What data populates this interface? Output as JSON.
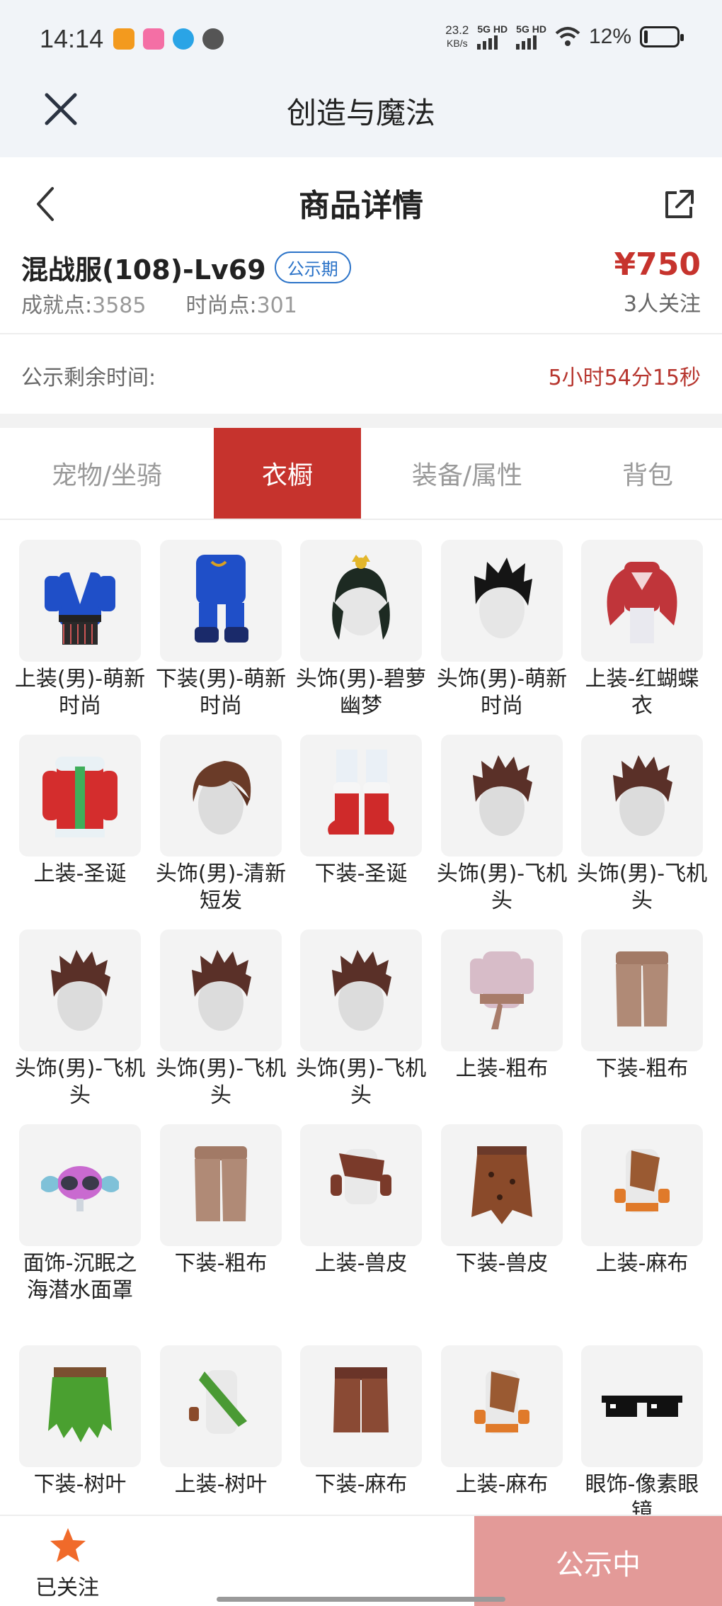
{
  "status_bar": {
    "time": "14:14",
    "net_speed": "23.2",
    "net_speed_unit": "KB/s",
    "sim1": "5G HD",
    "sim2": "5G HD",
    "battery_pct": "12%",
    "battery_level": 0.12
  },
  "app_header": {
    "title": "创造与魔法"
  },
  "page_header": {
    "title": "商品详情"
  },
  "product": {
    "name": "混战服(108)-Lv69",
    "badge": "公示期",
    "achievement_label": "成就点:",
    "achievement_value": "3585",
    "fashion_label": "时尚点:",
    "fashion_value": "301",
    "price": "¥750",
    "followers": "3人关注"
  },
  "countdown": {
    "label": "公示剩余时间:",
    "value": "5小时54分15秒"
  },
  "tabs": [
    {
      "label": "宠物/坐骑",
      "active": false
    },
    {
      "label": "衣橱",
      "active": true
    },
    {
      "label": "装备/属性",
      "active": false
    },
    {
      "label": "背包",
      "active": false
    }
  ],
  "items": [
    {
      "label": "上装(男)-萌新时尚",
      "icon": "blue-robe-icon"
    },
    {
      "label": "下装(男)-萌新时尚",
      "icon": "blue-pants-icon"
    },
    {
      "label": "头饰(男)-碧萝幽梦",
      "icon": "dark-hair-ornament-icon"
    },
    {
      "label": "头饰(男)-萌新时尚",
      "icon": "black-hair-icon"
    },
    {
      "label": "上装-红蝴蝶衣",
      "icon": "red-butterfly-top-icon"
    },
    {
      "label": "上装-圣诞",
      "icon": "christmas-coat-icon"
    },
    {
      "label": "头饰(男)-清新短发",
      "icon": "brown-short-hair-icon"
    },
    {
      "label": "下装-圣诞",
      "icon": "christmas-boots-icon"
    },
    {
      "label": "头饰(男)-飞机头",
      "icon": "pompadour-hair-icon"
    },
    {
      "label": "头饰(男)-飞机头",
      "icon": "pompadour-hair-icon"
    },
    {
      "label": "头饰(男)-飞机头",
      "icon": "pompadour-hair-icon"
    },
    {
      "label": "头饰(男)-飞机头",
      "icon": "pompadour-hair-icon"
    },
    {
      "label": "头饰(男)-飞机头",
      "icon": "pompadour-hair-icon"
    },
    {
      "label": "上装-粗布",
      "icon": "cloth-top-icon"
    },
    {
      "label": "下装-粗布",
      "icon": "cloth-shorts-icon"
    },
    {
      "label": "面饰-沉眠之海潜水面罩",
      "icon": "diving-mask-icon"
    },
    {
      "label": "下装-粗布",
      "icon": "cloth-shorts-icon"
    },
    {
      "label": "上装-兽皮",
      "icon": "beast-hide-top-icon"
    },
    {
      "label": "下装-兽皮",
      "icon": "beast-hide-skirt-icon"
    },
    {
      "label": "上装-麻布",
      "icon": "linen-top-icon"
    },
    {
      "label": "下装-树叶",
      "icon": "leaf-skirt-icon"
    },
    {
      "label": "上装-树叶",
      "icon": "leaf-top-icon"
    },
    {
      "label": "下装-麻布",
      "icon": "linen-shorts-icon"
    },
    {
      "label": "上装-麻布",
      "icon": "linen-top-icon"
    },
    {
      "label": "眼饰-像素眼镜",
      "icon": "pixel-glasses-icon"
    }
  ],
  "bottom_bar": {
    "follow_label": "已关注",
    "cta_label": "公示中"
  },
  "colors": {
    "accent": "#c6332d",
    "badge": "#2b73c8",
    "cta": "#e39a98"
  }
}
